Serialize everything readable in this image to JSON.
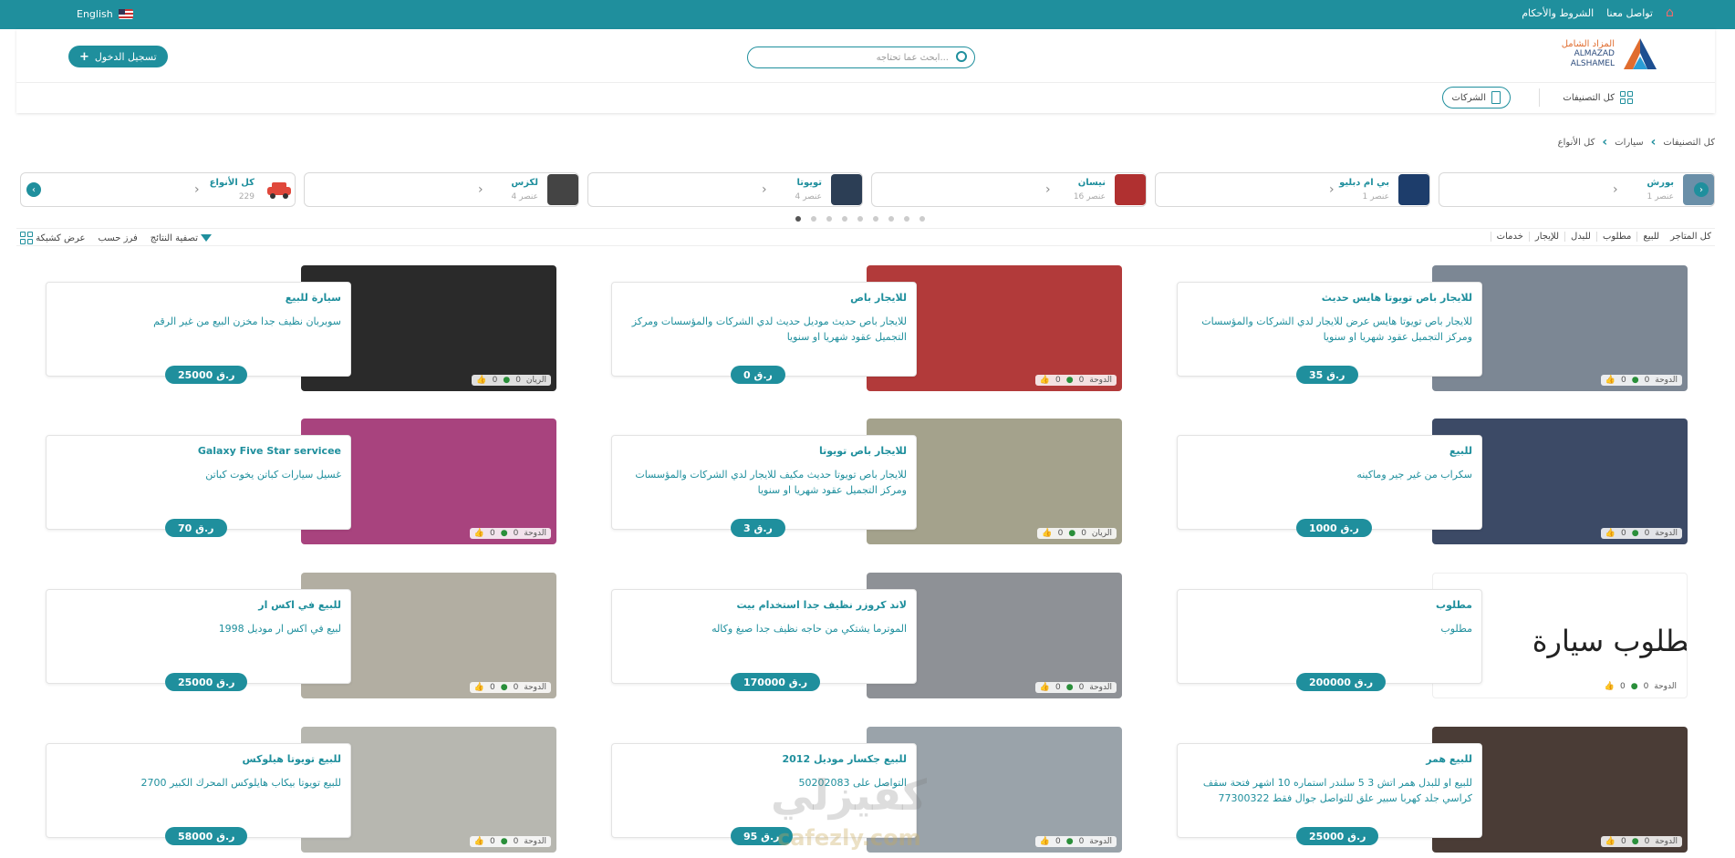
{
  "topbar": {
    "language": "English",
    "links": [
      "تواصل معنا",
      "الشروط والأحكام"
    ]
  },
  "header": {
    "login_label": "تسجيل الدخول",
    "search_placeholder": "ابحث عما تحتاجه...",
    "logo_ar": "المزاد الشامل",
    "logo_en1": "ALMAZAD",
    "logo_en2": "ALSHAMEL",
    "all_categories": "كل التصنيفات",
    "companies": "الشركات"
  },
  "breadcrumb": [
    "كل التصنيفات",
    "سيارات",
    "كل الأنواع"
  ],
  "brands": [
    {
      "name": "بورش",
      "count": "1 عنصر",
      "color": "#6a8fa8"
    },
    {
      "name": "بي ام دبليو",
      "count": "1 عنصر",
      "color": "#1d3d6b"
    },
    {
      "name": "نيسان",
      "count": "16 عنصر",
      "color": "#b03030"
    },
    {
      "name": "تويوتا",
      "count": "4 عنصر",
      "color": "#2c3e55"
    },
    {
      "name": "لكزس",
      "count": "4 عنصر",
      "color": "#444444"
    },
    {
      "name": "كل الأنواع",
      "count": "229",
      "color": "#e0483b"
    }
  ],
  "filters": {
    "tabs": [
      "كل المتاجر",
      "للبيع",
      "مطلوب",
      "للبدل",
      "للإيجار",
      "خدمات"
    ],
    "filter_results": "تصفية النتائج",
    "sort_by": "فرز حسب",
    "grid_view": "عرض كشبكة"
  },
  "listings": [
    {
      "title": "للايجار باص تويوتا هايس حديث",
      "desc": "للايجار باص تويوتا هايس عرض للايجار لدي الشركات والمؤسسات ومركز التجميل عقود شهريا او سنويا",
      "price": "35 ر.ق",
      "likes": "0",
      "comments": "0",
      "city": "الدوحة",
      "photo": "#7c8794"
    },
    {
      "title": "للايجار باص",
      "desc": "للايجار باص حديث موديل حديث لدي الشركات والمؤسسات ومركز التجميل عقود شهريا او سنويا",
      "price": "0 ر.ق",
      "likes": "0",
      "comments": "0",
      "city": "الدوحة",
      "photo": "#b23a3a"
    },
    {
      "title": "سيارة للبيع",
      "desc": "سوبربان نظيف جدا مخزن البيع من غير الرقم",
      "price": "25000 ر.ق",
      "likes": "0",
      "comments": "0",
      "city": "الريان",
      "photo": "#2a2a2a"
    },
    {
      "title": "للبيع",
      "desc": "سكراب من غير جير وماكينه",
      "price": "1000 ر.ق",
      "likes": "0",
      "comments": "0",
      "city": "الدوحة",
      "photo": "#3c4a66"
    },
    {
      "title": "للايجار باص تويوتا",
      "desc": "للايجار باص تويوتا حديث مكيف للايجار لدي الشركات والمؤسسات ومركز التجميل عقود شهريا او سنويا",
      "price": "3 ر.ق",
      "likes": "0",
      "comments": "0",
      "city": "الريان",
      "photo": "#a4a28c"
    },
    {
      "title": "Galaxy Five Star servicee",
      "desc": "غسيل سيارات كباتن يخوت كباتن",
      "price": "70 ر.ق",
      "likes": "0",
      "comments": "0",
      "city": "الدوحة",
      "photo": "#a8437e"
    },
    {
      "title": "مطلوب",
      "desc": "مطلوب",
      "price": "200000 ر.ق",
      "likes": "0",
      "comments": "0",
      "city": "الدوحة",
      "photo": "#ffffff",
      "photo_text": "مطلوب سيارة"
    },
    {
      "title": "لاند كروزر نظيف جدا استخدام بيت",
      "desc": "الموترما يشتكي من حاجه نظيف جدا صبغ وكاله",
      "price": "170000 ر.ق",
      "likes": "0",
      "comments": "0",
      "city": "الدوحة",
      "photo": "#8e9196"
    },
    {
      "title": "للبيع في اكس ار",
      "desc": "لبيع في اكس ار موديل 1998",
      "price": "25000 ر.ق",
      "likes": "0",
      "comments": "0",
      "city": "الدوحة",
      "photo": "#b2aea2"
    },
    {
      "title": "للبيع همر",
      "desc": "للبيع او للبدل همر اتش 3 5 سلندر استماره 10 اشهر فتحة سقف كراسي جلد كهربا سبير علق للتواصل جوال فقط 77300322",
      "price": "25000 ر.ق",
      "likes": "0",
      "comments": "0",
      "city": "الدوحة",
      "photo": "#4a3c36"
    },
    {
      "title": "للبيع جكسار موديل 2012",
      "desc": "التواصل على 50202083",
      "price": "95 ر.ق",
      "likes": "0",
      "comments": "0",
      "city": "الدوحة",
      "photo": "#9aa3aa"
    },
    {
      "title": "للبيع تويوتا هيلوكس",
      "desc": "للبيع تويوتا بيكاب هايلوكس المحرك الكبير 2700",
      "price": "58000 ر.ق",
      "likes": "0",
      "comments": "0",
      "city": "الدوحة",
      "photo": "#b7b7b0"
    }
  ],
  "watermark": "كفيزلي",
  "watermark_url": "cafezly.com"
}
